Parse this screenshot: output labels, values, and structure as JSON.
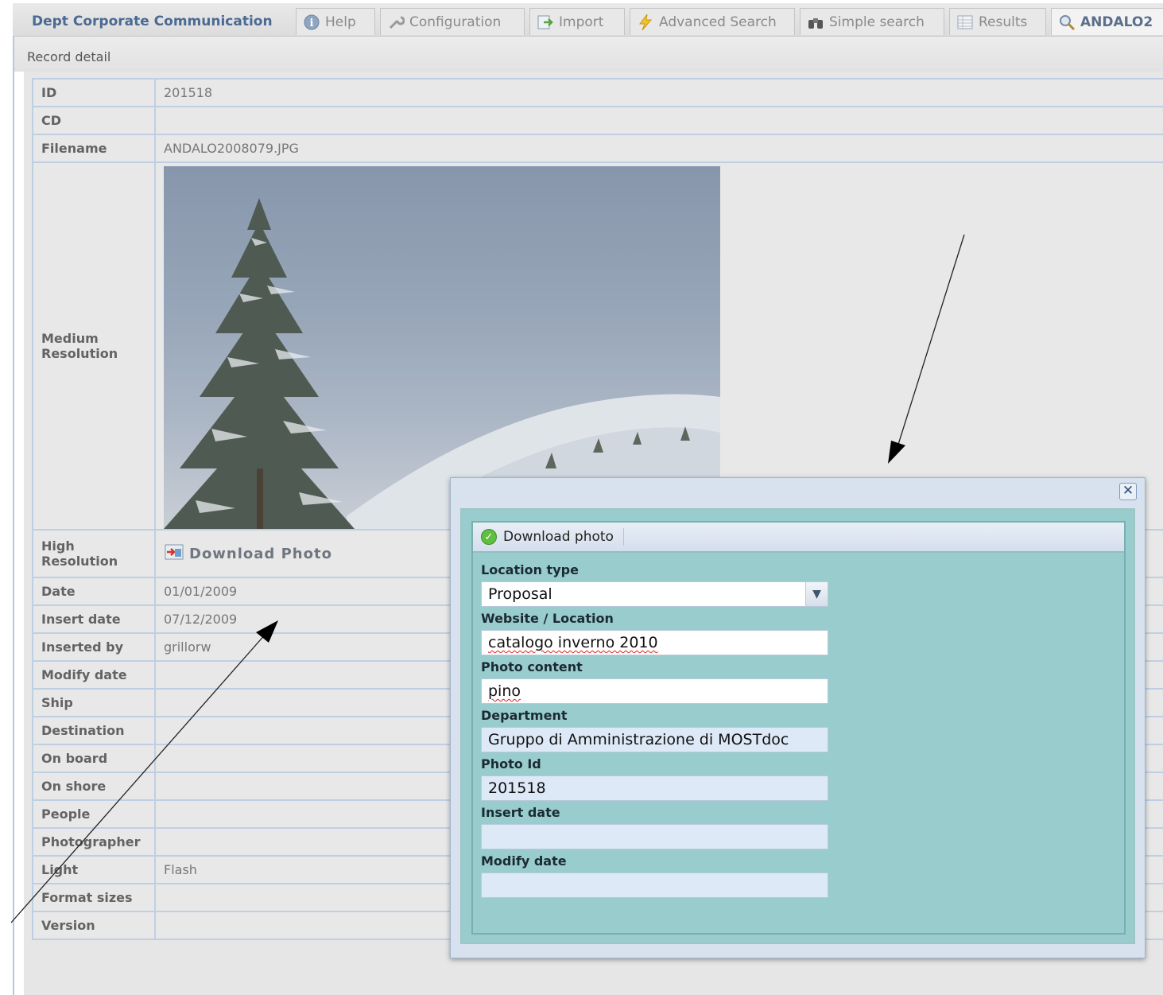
{
  "tabs": [
    {
      "label": "Dept Corporate Communication",
      "icon": ""
    },
    {
      "label": "Help",
      "icon": "info-icon"
    },
    {
      "label": "Configuration",
      "icon": "wrench-icon"
    },
    {
      "label": "Import",
      "icon": "import-icon"
    },
    {
      "label": "Advanced Search",
      "icon": "lightning-icon"
    },
    {
      "label": "Simple search",
      "icon": "binoculars-icon"
    },
    {
      "label": "Results",
      "icon": "table-icon"
    },
    {
      "label": "ANDALO2",
      "icon": "magnifier-icon"
    }
  ],
  "page": {
    "header": "Record detail"
  },
  "record": {
    "rows": [
      {
        "label": "ID",
        "value": "201518"
      },
      {
        "label": "CD",
        "value": ""
      },
      {
        "label": "Filename",
        "value": "ANDALO2008079.JPG"
      },
      {
        "label": "Medium Resolution",
        "value": ""
      },
      {
        "label": "High Resolution",
        "value": "Download Photo"
      },
      {
        "label": "Date",
        "value": "01/01/2009"
      },
      {
        "label": "Insert date",
        "value": "07/12/2009"
      },
      {
        "label": "Inserted by",
        "value": "grillorw"
      },
      {
        "label": "Modify date",
        "value": ""
      },
      {
        "label": "Ship",
        "value": ""
      },
      {
        "label": "Destination",
        "value": ""
      },
      {
        "label": "On board",
        "value": ""
      },
      {
        "label": "On shore",
        "value": ""
      },
      {
        "label": "People",
        "value": ""
      },
      {
        "label": "Photographer",
        "value": ""
      },
      {
        "label": "Light",
        "value": "Flash"
      },
      {
        "label": "Format sizes",
        "value": ""
      },
      {
        "label": "Version",
        "value": ""
      }
    ]
  },
  "dialog": {
    "toolbar": {
      "download_label": "Download photo"
    },
    "fields": {
      "location_type": {
        "label": "Location type",
        "value": "Proposal"
      },
      "website": {
        "label": "Website / Location",
        "value": "catalogo inverno 2010"
      },
      "content": {
        "label": "Photo content",
        "value": "pino"
      },
      "department": {
        "label": "Department",
        "value": "Gruppo di Amministrazione di MOSTdoc"
      },
      "photo_id": {
        "label": "Photo Id",
        "value": "201518"
      },
      "insert_date": {
        "label": "Insert date",
        "value": ""
      },
      "modify_date": {
        "label": "Modify date",
        "value": ""
      }
    }
  },
  "colors": {
    "accent": "#4a6a93",
    "dialog_bg": "#99cccc",
    "border": "#bfcfe3"
  }
}
